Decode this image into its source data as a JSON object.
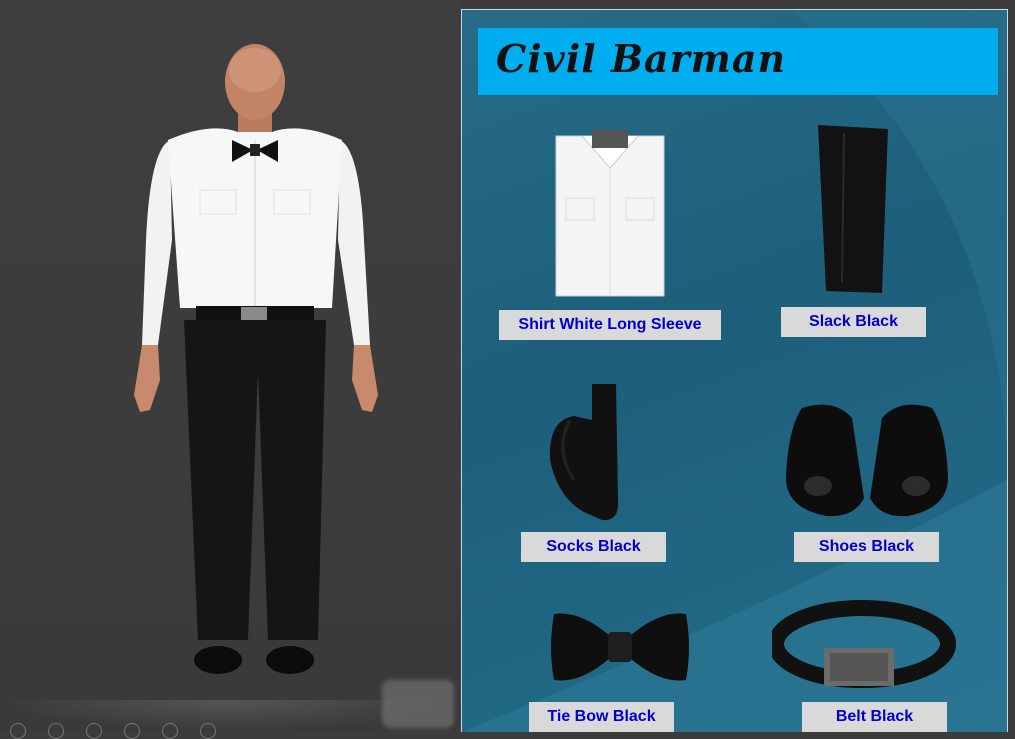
{
  "outfit": {
    "title": "Civil Barman",
    "items": [
      {
        "label": "Shirt White Long Sleeve",
        "icon": "white-shirt"
      },
      {
        "label": "Slack Black",
        "icon": "black-slacks"
      },
      {
        "label": "Socks Black",
        "icon": "black-socks"
      },
      {
        "label": "Shoes Black",
        "icon": "black-shoes"
      },
      {
        "label": "Tie Bow Black",
        "icon": "black-bow-tie"
      },
      {
        "label": "Belt Black",
        "icon": "black-belt"
      }
    ]
  },
  "colors": {
    "title_bar": "#00aeef",
    "panel": "#1f6280",
    "label_bg": "#d9d9d9",
    "label_text": "#0000cc"
  }
}
